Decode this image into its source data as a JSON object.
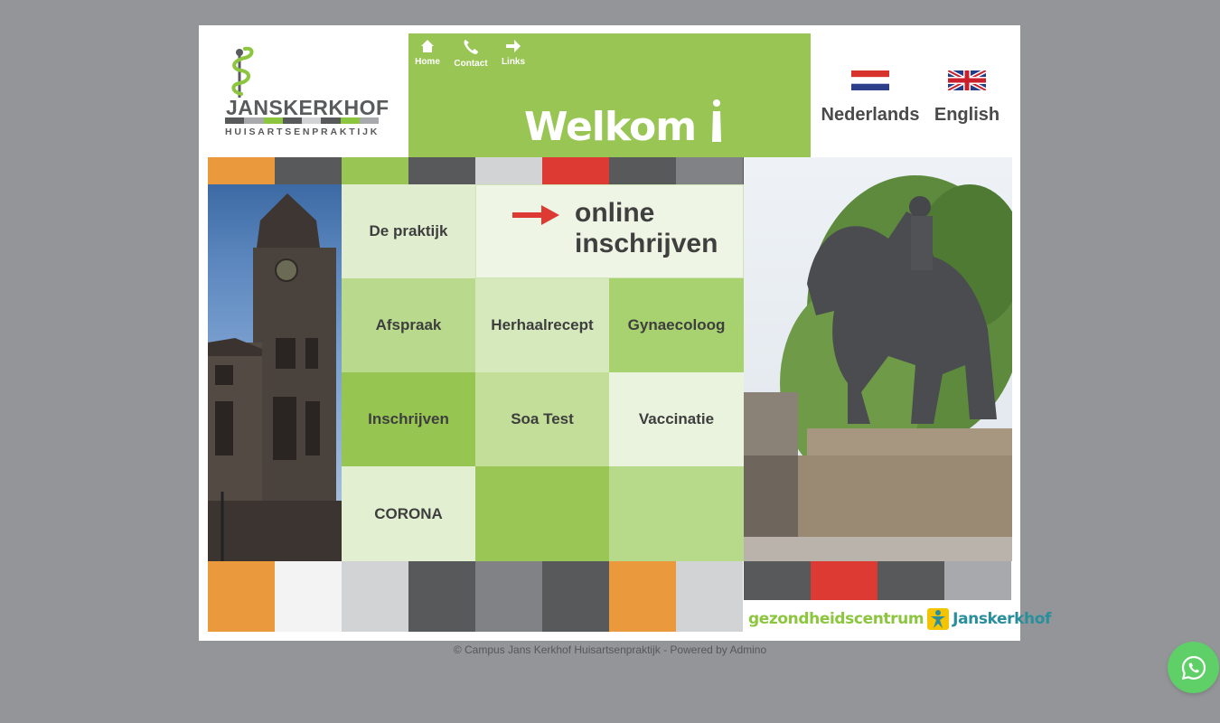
{
  "header": {
    "logo_text": "JANSKERKHOF",
    "logo_subtitle": "HUISARTSENPRAKTIJK",
    "welcome": "Welkom",
    "nav": [
      {
        "label": "Home",
        "icon": "home-icon"
      },
      {
        "label": "Contact",
        "icon": "phone-icon"
      },
      {
        "label": "Links",
        "icon": "arrow-right-icon"
      }
    ]
  },
  "languages": [
    {
      "label": "Nederlands",
      "icon": "dutch-flag-icon"
    },
    {
      "label": "English",
      "icon": "uk-flag-icon"
    }
  ],
  "menu": {
    "praktijk": "De praktijk",
    "online": [
      "online",
      "inschrijven"
    ],
    "afspraak": "Afspraak",
    "herhaalrecept": "Herhaalrecept",
    "gynaecoloog": "Gynaecoloog",
    "inschrijven": "Inschrijven",
    "soa_test": "Soa Test",
    "vaccinatie": "Vaccinatie",
    "corona": "CORONA"
  },
  "partner_logo": {
    "part1": "gezondheidscentrum",
    "part2": "Janskerkhof"
  },
  "footer": "© Campus Jans Kerkhof Huisartsenpraktijk - Powered by Admino",
  "colors": {
    "page_bg": "#939598",
    "header_green": "#99c554",
    "orange": "#ea9a3c",
    "red": "#dc3a32",
    "dark_gray": "#58595b",
    "whatsapp_green": "#5fcf67"
  }
}
